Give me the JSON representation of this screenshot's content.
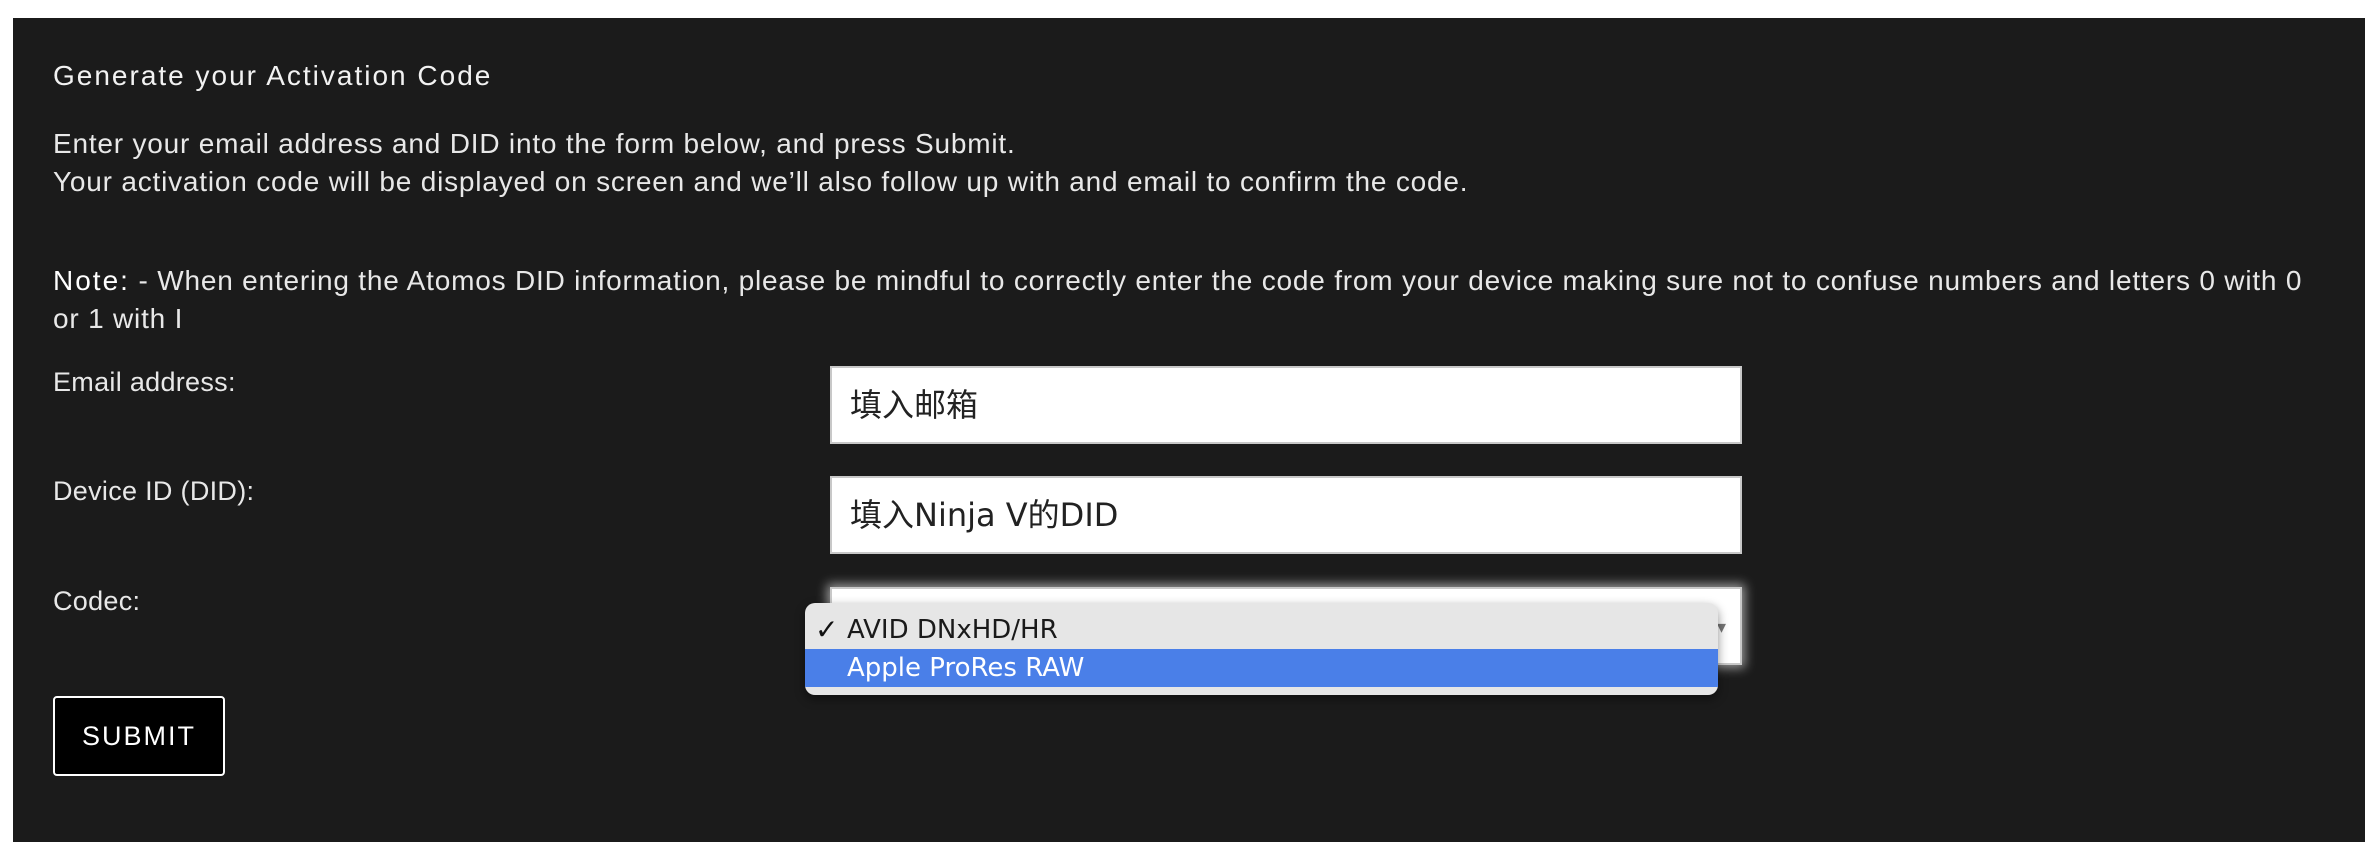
{
  "page": {
    "title": "Generate your Activation Code",
    "intro_line1": "Enter your email address and DID into the form below, and press Submit.",
    "intro_line2": "Your activation code will be displayed on screen and we’ll also follow up with and email to confirm the code.",
    "note_label": "Note:",
    "note_text": " - When entering the Atomos DID information, please be mindful to correctly enter the code from your device making sure not to confuse numbers and letters 0 with 0 or 1 with I"
  },
  "form": {
    "email": {
      "label": "Email address:",
      "value": "填入邮箱"
    },
    "did": {
      "label": "Device ID (DID):",
      "value": "填入Ninja V的DID"
    },
    "codec": {
      "label": "Codec:",
      "options": [
        "AVID DNxHD/HR",
        "Apple ProRes RAW"
      ],
      "checked_option": "AVID DNxHD/HR",
      "highlighted_option": "Apple ProRes RAW",
      "check_icon": "✓",
      "arrow_icon": "▾"
    },
    "submit_label": "SUBMIT"
  },
  "colors": {
    "panel_bg": "#1b1b1b",
    "highlight": "#4a7fe8",
    "text": "#e8e8e8"
  }
}
